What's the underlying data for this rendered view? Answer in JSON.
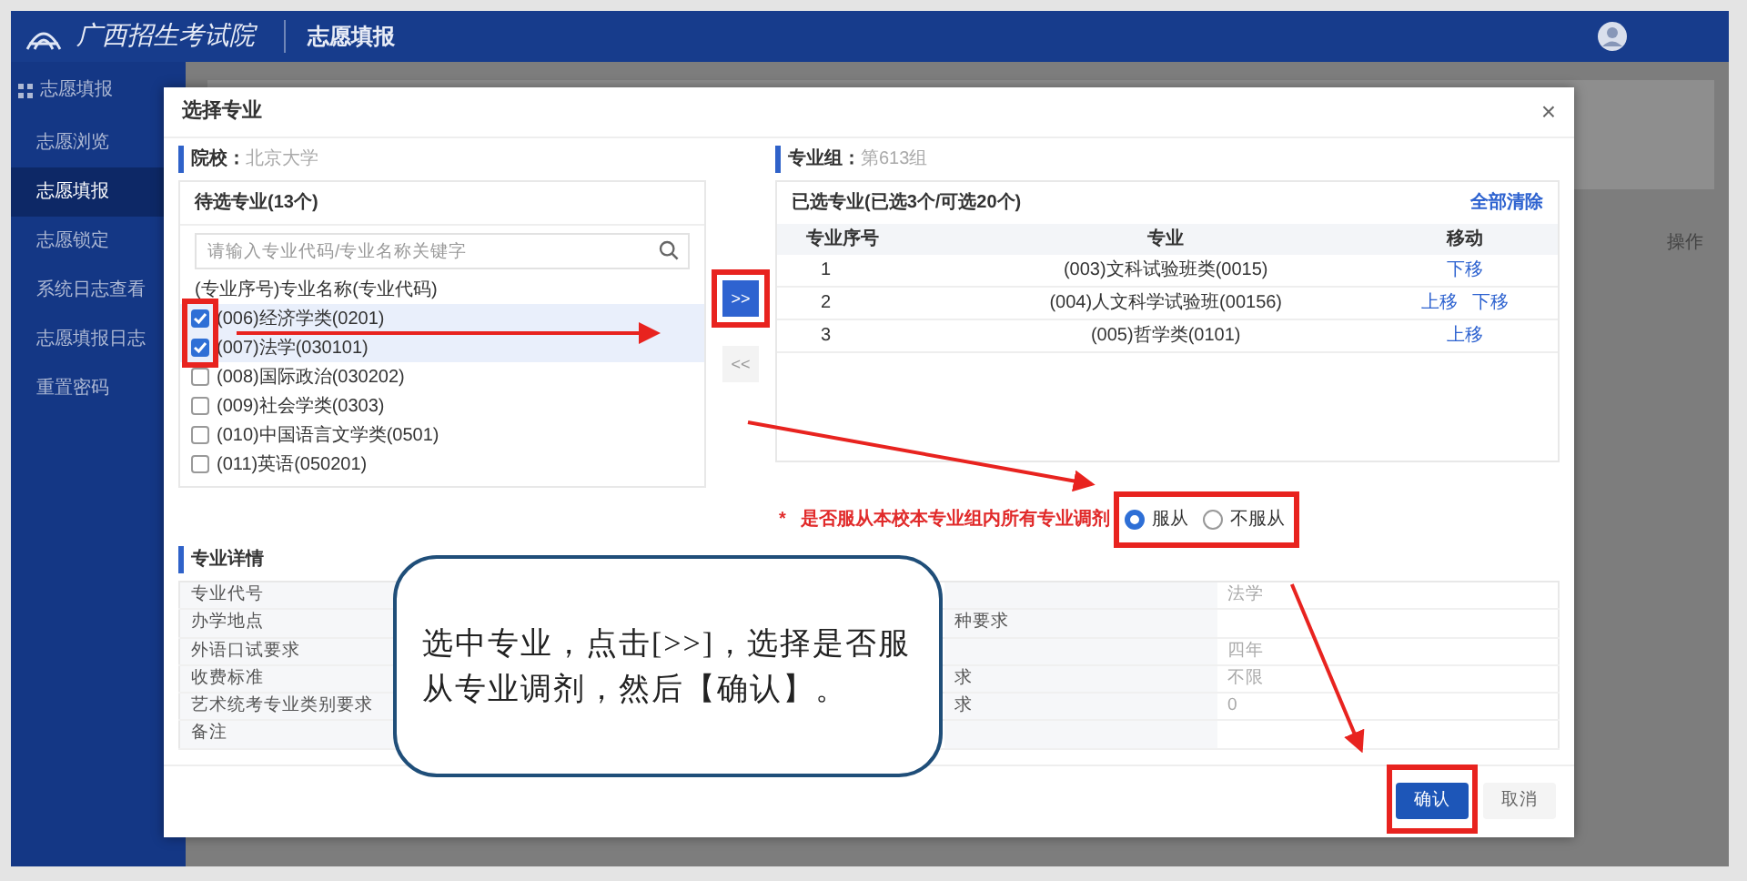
{
  "header": {
    "logo_text": "广西招生考试院",
    "title": "志愿填报"
  },
  "sidebar": {
    "title": "志愿填报",
    "items": [
      {
        "label": "志愿浏览",
        "selected": false
      },
      {
        "label": "志愿填报",
        "selected": true
      },
      {
        "label": "志愿锁定",
        "selected": false
      },
      {
        "label": "系统日志查看",
        "selected": false
      },
      {
        "label": "志愿填报日志",
        "selected": false
      },
      {
        "label": "重置密码",
        "selected": false
      }
    ]
  },
  "background_table": {
    "column": "操作"
  },
  "dialog": {
    "title": "选择专业",
    "close": "×",
    "school": {
      "label": "院校：",
      "value": "北京大学"
    },
    "candidates": {
      "title": "待选专业(13个)",
      "search_placeholder": "请输入专业代码/专业名称关键字",
      "column": "(专业序号)专业名称(专业代码)",
      "items": [
        {
          "label": "(006)经济学类(0201)",
          "checked": true
        },
        {
          "label": "(007)法学(030101)",
          "checked": true
        },
        {
          "label": "(008)国际政治(030202)",
          "checked": false
        },
        {
          "label": "(009)社会学类(0303)",
          "checked": false
        },
        {
          "label": "(010)中国语言文学类(0501)",
          "checked": false
        },
        {
          "label": "(011)英语(050201)",
          "checked": false
        }
      ]
    },
    "move_buttons": [
      {
        "label": ">>",
        "kind": "primary"
      },
      {
        "label": "<<",
        "kind": "plain"
      }
    ],
    "group": {
      "label": "专业组：",
      "value": "第613组"
    },
    "selected": {
      "title": "已选专业(已选3个/可选20个)",
      "clear_all": "全部清除",
      "columns": [
        "专业序号",
        "专业",
        "移动"
      ],
      "rows": [
        {
          "index": "1",
          "major": "(003)文科试验班类(0015)",
          "actions": [
            "下移"
          ]
        },
        {
          "index": "2",
          "major": "(004)人文科学试验班(00156)",
          "actions": [
            "上移",
            "下移"
          ]
        },
        {
          "index": "3",
          "major": "(005)哲学类(0101)",
          "actions": [
            "上移"
          ]
        }
      ]
    },
    "adjust": {
      "required_mark": "*",
      "question": "是否服从本校本专业组内所有专业调剂",
      "options": [
        {
          "label": "服从",
          "selected": true
        },
        {
          "label": "不服从",
          "selected": false
        }
      ]
    },
    "details": {
      "title": "专业详情",
      "rows": [
        {
          "label": "专业代号",
          "right_value": "法学"
        },
        {
          "label": "办学地点",
          "right_label": "种要求"
        },
        {
          "label": "外语口试要求",
          "right_value": "四年"
        },
        {
          "label": "收费标准",
          "right_label": "求",
          "right_value": "不限"
        },
        {
          "label": "艺术统考专业类别要求",
          "right_label": "求",
          "right_value": "0"
        },
        {
          "label": "备注"
        }
      ]
    },
    "buttons": [
      {
        "label": "确认",
        "kind": "primary"
      },
      {
        "label": "取消",
        "kind": "secondary"
      }
    ]
  },
  "annotation": {
    "text": "选中专业，点击[>>]，选择是否服从专业调剂，然后【确认】。"
  }
}
